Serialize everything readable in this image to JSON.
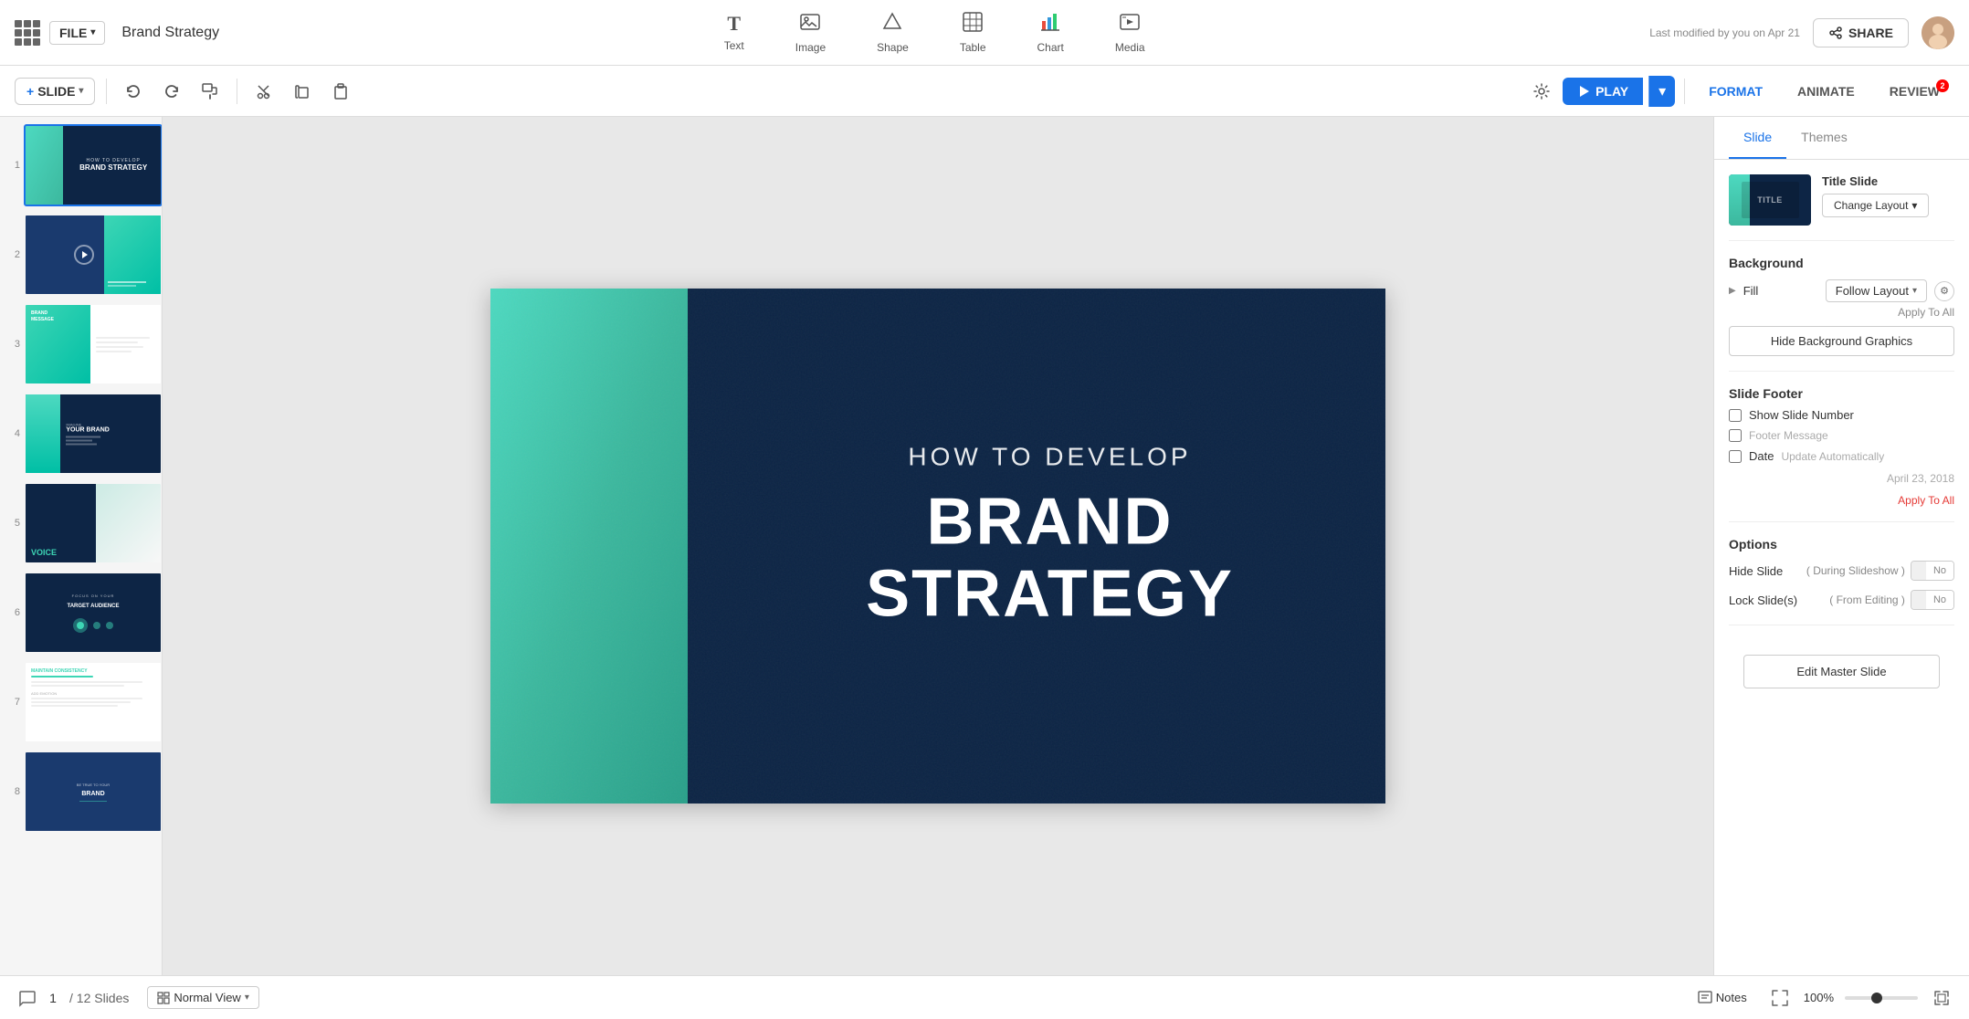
{
  "app": {
    "grid_icon": "grid",
    "file_label": "FILE",
    "doc_title": "Brand Strategy",
    "last_modified": "Last modified by you on Apr 21",
    "share_label": "SHARE"
  },
  "toolbar": {
    "tools": [
      {
        "id": "text",
        "label": "Text",
        "icon": "T"
      },
      {
        "id": "image",
        "label": "Image",
        "icon": "🖼"
      },
      {
        "id": "shape",
        "label": "Shape",
        "icon": "⬟"
      },
      {
        "id": "table",
        "label": "Table",
        "icon": "⊞"
      },
      {
        "id": "chart",
        "label": "Chart",
        "icon": "📊"
      },
      {
        "id": "media",
        "label": "Media",
        "icon": "🎬"
      }
    ],
    "play_label": "PLAY",
    "format_label": "FORMAT",
    "animate_label": "ANIMATE",
    "review_label": "REVIEW",
    "review_badge": "2"
  },
  "toolbar2": {
    "slide_label": "SLIDE",
    "undo_icon": "↩",
    "redo_icon": "↪",
    "paint_icon": "🎨",
    "cut_icon": "✂",
    "copy_icon": "⧉",
    "paste_icon": "📋"
  },
  "slides": [
    {
      "num": 1,
      "active": true
    },
    {
      "num": 2,
      "active": false
    },
    {
      "num": 3,
      "active": false
    },
    {
      "num": 4,
      "active": false
    },
    {
      "num": 5,
      "active": false
    },
    {
      "num": 6,
      "active": false
    },
    {
      "num": 7,
      "active": false
    },
    {
      "num": 8,
      "active": false
    }
  ],
  "slide": {
    "subtitle": "HOW TO DEVELOP",
    "title": "BRAND STRATEGY"
  },
  "right_panel": {
    "tabs": [
      {
        "id": "slide",
        "label": "Slide",
        "active": true
      },
      {
        "id": "themes",
        "label": "Themes",
        "active": false
      }
    ],
    "layout": {
      "title": "Title Slide",
      "change_label": "Change Layout",
      "change_caret": "▾"
    },
    "background": {
      "section_title": "Background",
      "fill_label": "Fill",
      "fill_value": "Follow Layout",
      "apply_all_label": "Apply To All",
      "hide_bg_label": "Hide Background Graphics"
    },
    "footer": {
      "section_title": "Slide Footer",
      "show_slide_num_label": "Show Slide Number",
      "footer_msg_label": "Footer Message",
      "date_label": "Date",
      "date_sublabel": "Update Automatically",
      "date_value": "April 23, 2018",
      "apply_all_label": "Apply To All"
    },
    "options": {
      "section_title": "Options",
      "hide_slide_label": "Hide Slide",
      "hide_slide_sublabel": "( During Slideshow )",
      "hide_slide_toggle": [
        "",
        "No"
      ],
      "lock_slides_label": "Lock Slide(s)",
      "lock_slides_sublabel": "( From Editing )",
      "lock_toggle": [
        "",
        "No"
      ]
    },
    "edit_master_label": "Edit Master Slide"
  },
  "bottom_bar": {
    "slide_num": "1",
    "slide_total": "/ 12 Slides",
    "view_label": "Normal View",
    "notes_label": "Notes",
    "zoom_level": "100%"
  }
}
